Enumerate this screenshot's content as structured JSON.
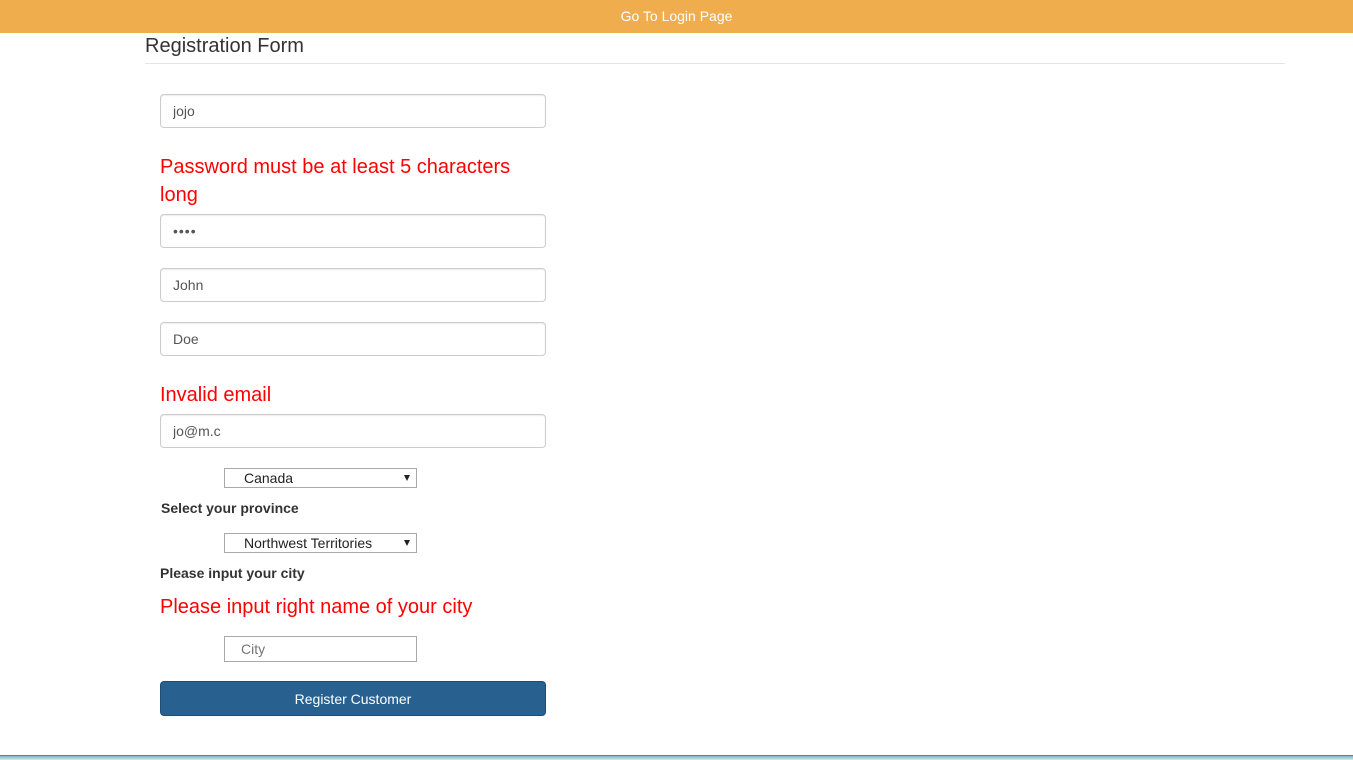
{
  "topbar": {
    "link_label": "Go To Login Page",
    "background": "#f0ad4e"
  },
  "form": {
    "title": "Registration Form",
    "username_value": "jojo",
    "password_error": "Password must be at least 5 characters long",
    "password_value": "••••",
    "firstname_value": "John",
    "lastname_value": "Doe",
    "email_error": "Invalid email",
    "email_value": "jo@m.c",
    "country_selected": "Canada",
    "province_label": "Select your province",
    "province_selected": "Northwest Territories",
    "city_label": "Please input your city",
    "city_error": "Please input right name of your city",
    "city_placeholder": "City",
    "submit_label": "Register Customer",
    "error_color": "#ff0000",
    "button_color": "#286090"
  }
}
